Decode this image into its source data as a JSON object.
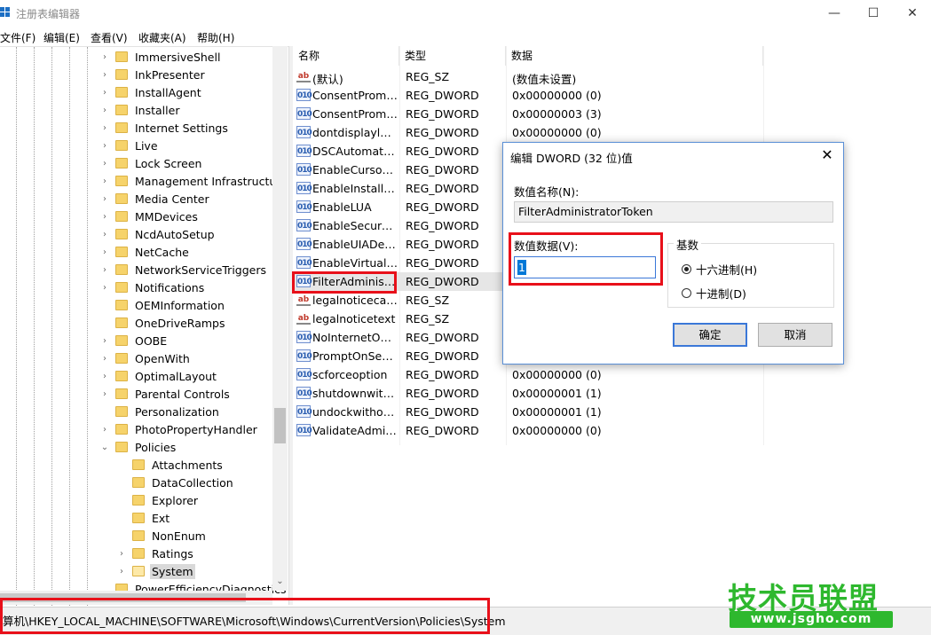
{
  "window": {
    "title": "注册表编辑器",
    "minimize_glyph": "—",
    "maximize_glyph": "☐",
    "close_glyph": "✕"
  },
  "menu": [
    "文件(F)",
    "编辑(E)",
    "查看(V)",
    "收藏夹(A)",
    "帮助(H)"
  ],
  "tree": {
    "items": [
      {
        "label": "ImmersiveShell",
        "expander": "›"
      },
      {
        "label": "InkPresenter",
        "expander": "›"
      },
      {
        "label": "InstallAgent",
        "expander": "›"
      },
      {
        "label": "Installer",
        "expander": "›"
      },
      {
        "label": "Internet Settings",
        "expander": "›"
      },
      {
        "label": "Live",
        "expander": "›"
      },
      {
        "label": "Lock Screen",
        "expander": "›"
      },
      {
        "label": "Management Infrastructure",
        "expander": "›"
      },
      {
        "label": "Media Center",
        "expander": "›"
      },
      {
        "label": "MMDevices",
        "expander": "›"
      },
      {
        "label": "NcdAutoSetup",
        "expander": "›"
      },
      {
        "label": "NetCache",
        "expander": "›"
      },
      {
        "label": "NetworkServiceTriggers",
        "expander": "›"
      },
      {
        "label": "Notifications",
        "expander": "›"
      },
      {
        "label": "OEMInformation",
        "expander": ""
      },
      {
        "label": "OneDriveRamps",
        "expander": ""
      },
      {
        "label": "OOBE",
        "expander": "›"
      },
      {
        "label": "OpenWith",
        "expander": "›"
      },
      {
        "label": "OptimalLayout",
        "expander": "›"
      },
      {
        "label": "Parental Controls",
        "expander": "›"
      },
      {
        "label": "Personalization",
        "expander": ""
      },
      {
        "label": "PhotoPropertyHandler",
        "expander": "›"
      },
      {
        "label": "Policies",
        "expander": "⌄"
      },
      {
        "label": "Attachments",
        "expander": ""
      },
      {
        "label": "DataCollection",
        "expander": ""
      },
      {
        "label": "Explorer",
        "expander": ""
      },
      {
        "label": "Ext",
        "expander": ""
      },
      {
        "label": "NonEnum",
        "expander": ""
      },
      {
        "label": "Ratings",
        "expander": "›"
      },
      {
        "label": "System",
        "expander": "›"
      },
      {
        "label": "PowerEfficiencyDiagnostics",
        "expander": ""
      }
    ],
    "scroll_down_glyph": "⌄"
  },
  "list": {
    "headers": {
      "name": "名称",
      "type": "类型",
      "data": "数据"
    },
    "rows": [
      {
        "icon": "ab",
        "name": "(默认)",
        "type": "REG_SZ",
        "data": "(数值未设置)"
      },
      {
        "icon": "010",
        "name": "ConsentPromptBehaviorAdmin",
        "type": "REG_DWORD",
        "data": "0x00000000 (0)"
      },
      {
        "icon": "010",
        "name": "ConsentPromptBehaviorUser",
        "type": "REG_DWORD",
        "data": "0x00000003 (3)"
      },
      {
        "icon": "010",
        "name": "dontdisplaylastusername",
        "type": "REG_DWORD",
        "data": "0x00000000 (0)"
      },
      {
        "icon": "010",
        "name": "DSCAutomationHostEnabled",
        "type": "REG_DWORD",
        "data": ""
      },
      {
        "icon": "010",
        "name": "EnableCursorSuppression",
        "type": "REG_DWORD",
        "data": ""
      },
      {
        "icon": "010",
        "name": "EnableInstallerDetection",
        "type": "REG_DWORD",
        "data": ""
      },
      {
        "icon": "010",
        "name": "EnableLUA",
        "type": "REG_DWORD",
        "data": ""
      },
      {
        "icon": "010",
        "name": "EnableSecureUIAPaths",
        "type": "REG_DWORD",
        "data": ""
      },
      {
        "icon": "010",
        "name": "EnableUIADesktopToggle",
        "type": "REG_DWORD",
        "data": ""
      },
      {
        "icon": "010",
        "name": "EnableVirtualization",
        "type": "REG_DWORD",
        "data": ""
      },
      {
        "icon": "010",
        "name": "FilterAdministratorToken",
        "type": "REG_DWORD",
        "data": ""
      },
      {
        "icon": "ab",
        "name": "legalnoticecaption",
        "type": "REG_SZ",
        "data": ""
      },
      {
        "icon": "ab",
        "name": "legalnoticetext",
        "type": "REG_SZ",
        "data": ""
      },
      {
        "icon": "010",
        "name": "NoInternetOpenWith",
        "type": "REG_DWORD",
        "data": ""
      },
      {
        "icon": "010",
        "name": "PromptOnSecureDesktop",
        "type": "REG_DWORD",
        "data": ""
      },
      {
        "icon": "010",
        "name": "scforceoption",
        "type": "REG_DWORD",
        "data": "0x00000000 (0)"
      },
      {
        "icon": "010",
        "name": "shutdownwithoutlogon",
        "type": "REG_DWORD",
        "data": "0x00000001 (1)"
      },
      {
        "icon": "010",
        "name": "undockwithoutlogon",
        "type": "REG_DWORD",
        "data": "0x00000001 (1)"
      },
      {
        "icon": "010",
        "name": "ValidateAdminCodeSignatures",
        "type": "REG_DWORD",
        "data": "0x00000000 (0)"
      }
    ]
  },
  "status": {
    "path": "算机\\HKEY_LOCAL_MACHINE\\SOFTWARE\\Microsoft\\Windows\\CurrentVersion\\Policies\\System"
  },
  "dialog": {
    "title": "编辑 DWORD (32 位)值",
    "close_glyph": "✕",
    "name_label": "数值名称(N):",
    "name_value": "FilterAdministratorToken",
    "data_label": "数值数据(V):",
    "data_value": "1",
    "base_label": "基数",
    "radio_hex": "十六进制(H)",
    "radio_dec": "十进制(D)",
    "selected_base": "hex",
    "ok": "确定",
    "cancel": "取消"
  },
  "watermark": {
    "big": "技术员联盟",
    "small": "www.jsgho.com"
  },
  "colors": {
    "highlight": "#e8101a",
    "selection": "#0078d7",
    "watermark": "#2eb82e"
  }
}
